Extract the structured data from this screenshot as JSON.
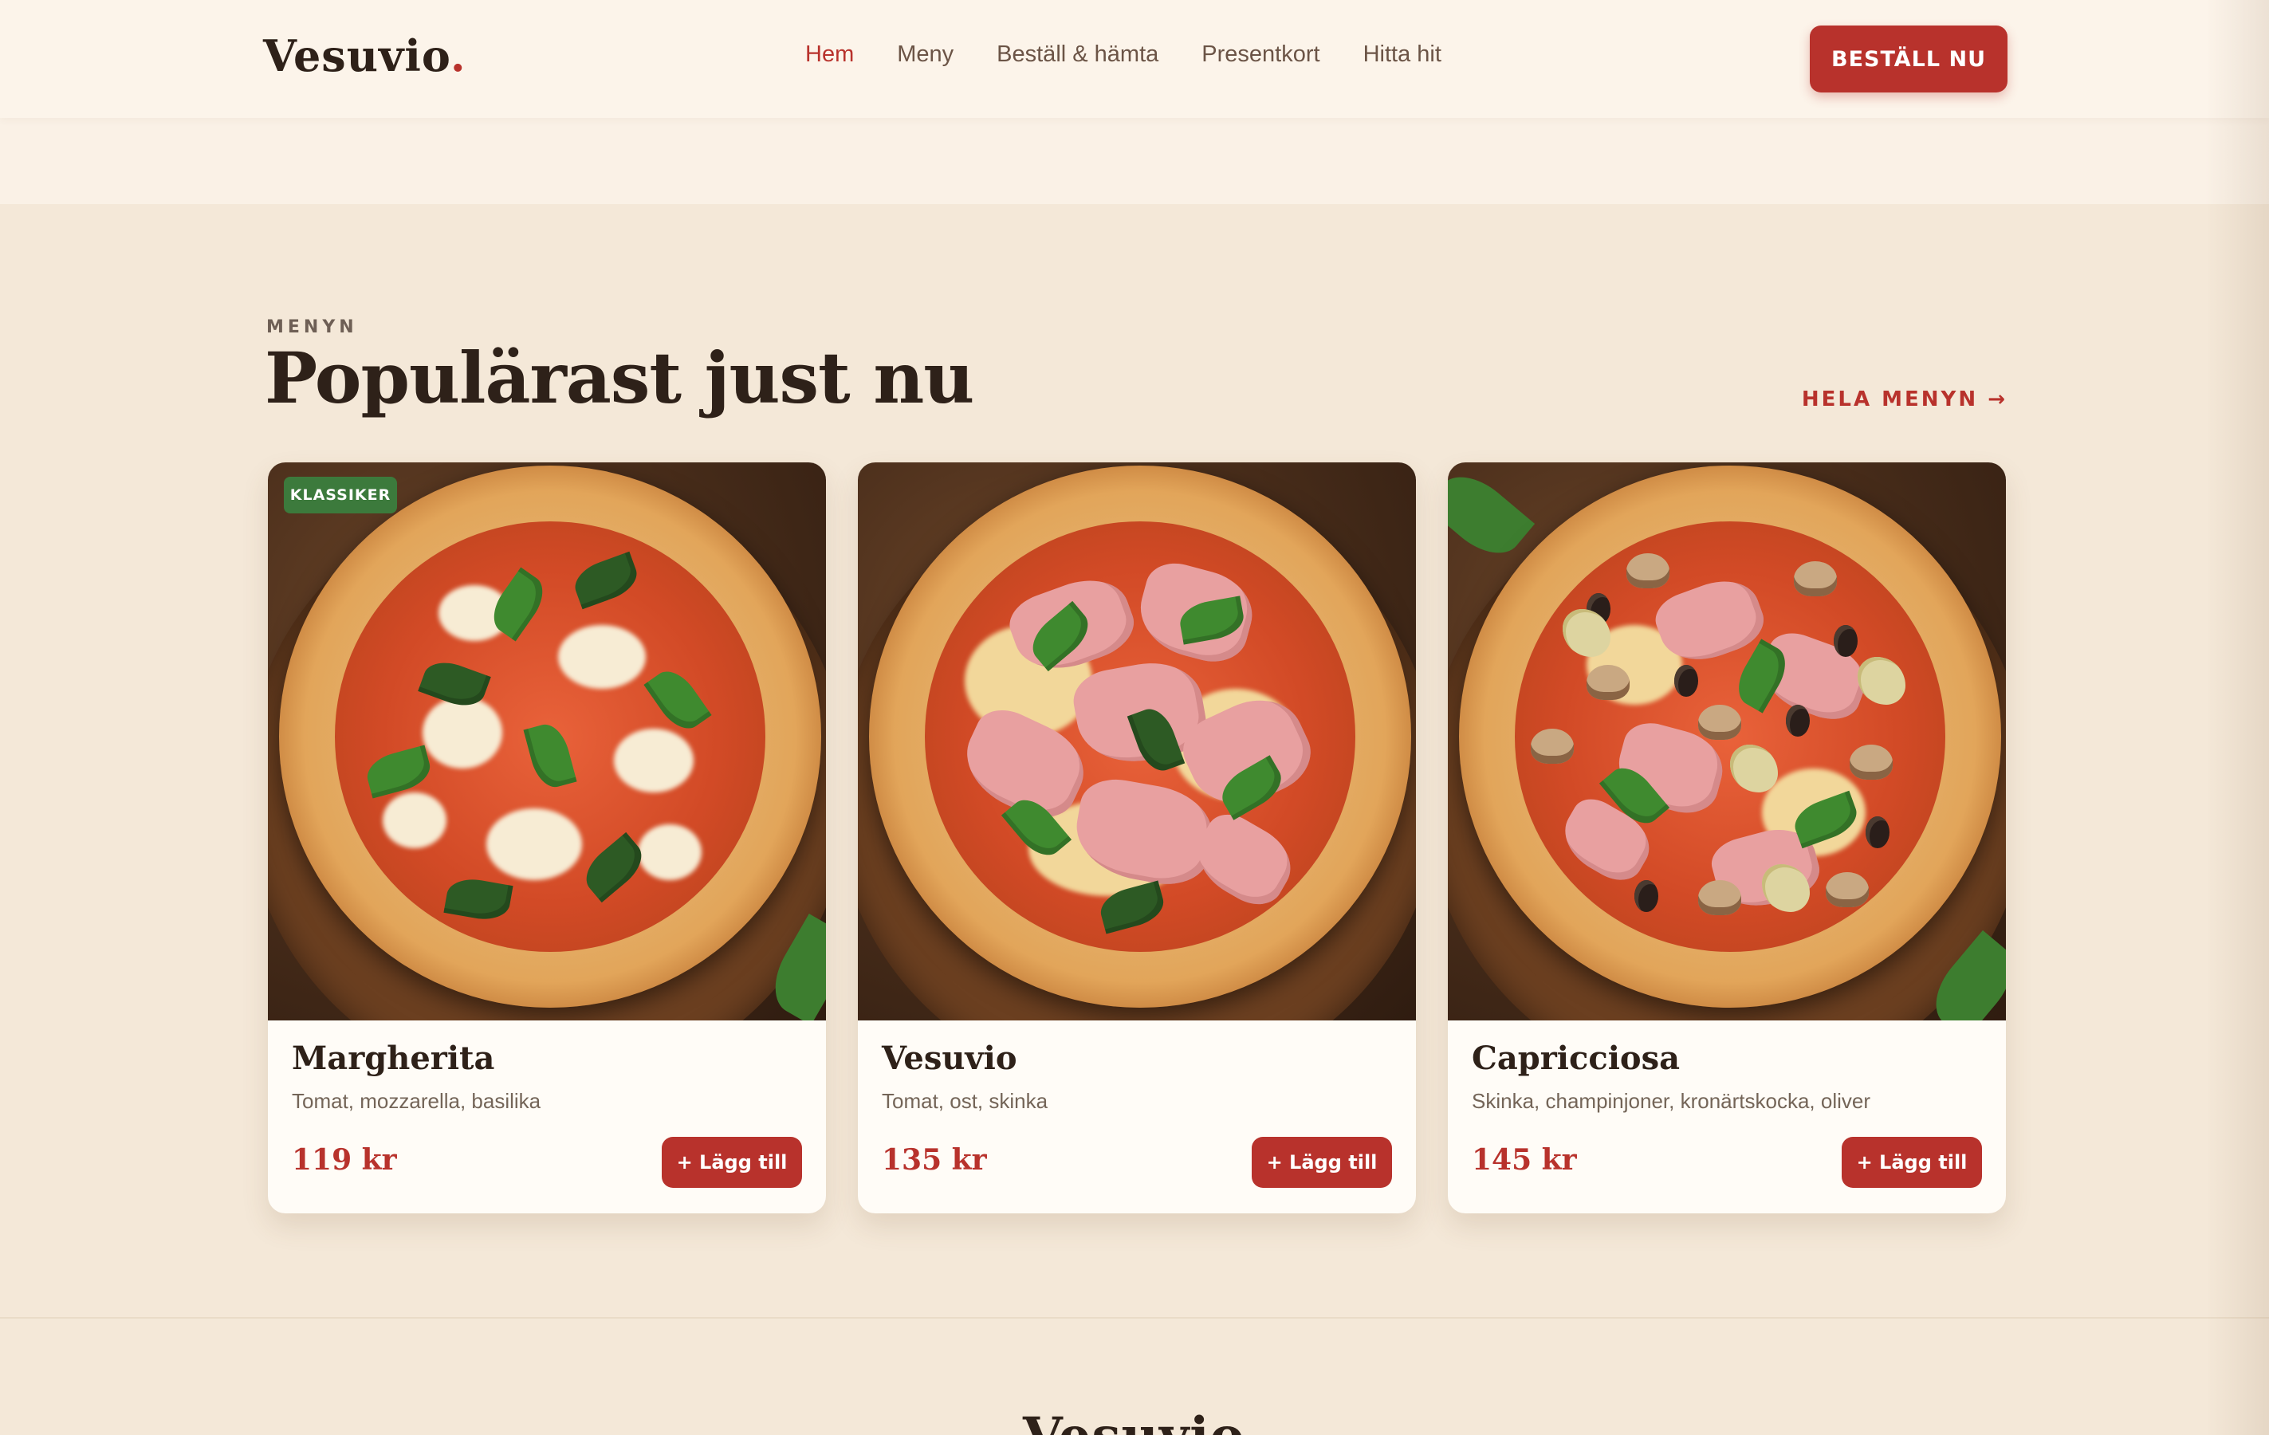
{
  "header": {
    "logo": "Vesuvio",
    "logo_dot": ".",
    "nav": [
      "Hem",
      "Meny",
      "Beställ & hämta",
      "Presentkort",
      "Hitta hit"
    ],
    "cta": "BESTÄLL NU"
  },
  "section": {
    "eyebrow": "MENYN",
    "title": "Populärast just nu",
    "link": "HELA MENYN →"
  },
  "cards": [
    {
      "badge": "KLASSIKER",
      "name": "Margherita",
      "desc": "Tomat, mozzarella, basilika",
      "price": "119 kr",
      "button": "+ Lägg till"
    },
    {
      "name": "Vesuvio",
      "desc": "Tomat, ost, skinka",
      "price": "135 kr",
      "button": "+ Lägg till"
    },
    {
      "name": "Capricciosa",
      "desc": "Skinka, champinjoner, kronärtskocka, oliver",
      "price": "145 kr",
      "button": "+ Lägg till"
    }
  ],
  "footer": {
    "logo": "Vesuvio"
  },
  "colors": {
    "accent": "#b8322c",
    "badge": "#3c7a3c",
    "background": "#f4e8d8",
    "text": "#2e2119"
  }
}
